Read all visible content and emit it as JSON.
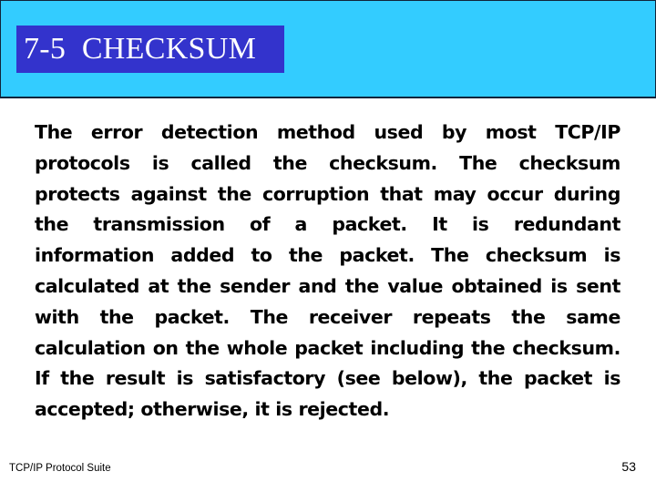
{
  "slide": {
    "title": "7-5  CHECKSUM",
    "colors": {
      "header_band": "#33CCFF",
      "title_box": "#3333CC",
      "title_text": "#FFFFFF",
      "body_text": "#000000"
    },
    "body_lines": [
      "The error detection method used by most TCP/IP",
      "protocols is called the checksum. The checksum",
      "protects against the corruption that may occur during",
      "the transmission of a packet. It is redundant",
      "information added to the packet. The checksum is",
      "calculated at the sender and the value obtained is sent",
      "with the packet. The receiver repeats the same",
      "calculation on the whole packet including the checksum.",
      "If the result is satisfactory (see below), the packet is",
      "accepted; otherwise, it is rejected."
    ]
  },
  "footer": {
    "left_text": "TCP/IP Protocol Suite",
    "page_number": "53"
  }
}
